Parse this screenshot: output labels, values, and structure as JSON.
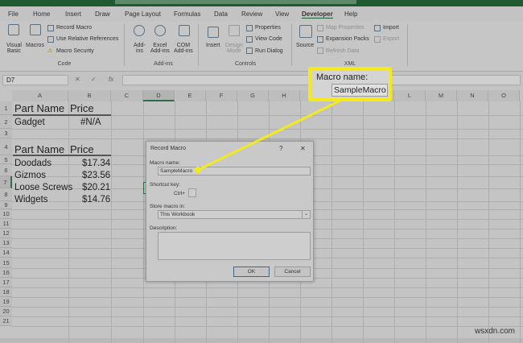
{
  "ribbon": {
    "tabs": [
      "File",
      "Home",
      "Insert",
      "Draw",
      "Page Layout",
      "Formulas",
      "Data",
      "Review",
      "View",
      "Developer",
      "Help"
    ],
    "active_tab": "Developer",
    "code": {
      "visual_basic": [
        "Visual",
        "Basic"
      ],
      "macros": "Macros",
      "record_macro": "Record Macro",
      "use_relative": "Use Relative References",
      "macro_security": "Macro Security",
      "label": "Code"
    },
    "addins": {
      "addins": [
        "Add-",
        "ins"
      ],
      "excel": [
        "Excel",
        "Add-ins"
      ],
      "com": [
        "COM",
        "Add-ins"
      ],
      "label": "Add-ins"
    },
    "controls": {
      "insert": "Insert",
      "design": [
        "Design",
        "Mode"
      ],
      "properties": "Properties",
      "view_code": "View Code",
      "run_dialog": "Run Dialog",
      "label": "Controls"
    },
    "xml": {
      "source": "Source",
      "map_properties": "Map Properties",
      "expansion_packs": "Expansion Packs",
      "refresh_data": "Refresh Data",
      "import": "Import",
      "export": "Export",
      "label": "XML"
    }
  },
  "formula_bar": {
    "name_box": "D7",
    "cancel": "✕",
    "enter": "✓",
    "fx": "fx",
    "value": ""
  },
  "columns": [
    "A",
    "B",
    "C",
    "D",
    "E",
    "F",
    "G",
    "H",
    "I",
    "J",
    "K",
    "L",
    "M",
    "N",
    "O"
  ],
  "rows": [
    "1",
    "2",
    "3",
    "4",
    "5",
    "6",
    "7",
    "8",
    "9",
    "10",
    "11",
    "12",
    "13",
    "14",
    "15",
    "16",
    "17",
    "18",
    "19",
    "20",
    "21"
  ],
  "cells": {
    "a1": "Part Name",
    "b1": "Price",
    "a2": "Gadget",
    "b2": "#N/A",
    "a4": "Part Name",
    "b4": "Price",
    "a5": "Doodads",
    "b5": "$17.34",
    "a6": "Gizmos",
    "b6": "$23.56",
    "a7": "Loose Screws",
    "b7": "$20.21",
    "a8": "Widgets",
    "b8": "$14.76"
  },
  "dialog": {
    "title": "Record Macro",
    "help": "?",
    "close": "✕",
    "macro_name_label": "Macro name:",
    "macro_name": "SampleMacro",
    "shortcut_label": "Shortcut key:",
    "ctrl": "Ctrl+",
    "store_label": "Store macro in:",
    "store_value": "This Workbook",
    "description_label": "Description:",
    "ok": "OK",
    "cancel": "Cancel"
  },
  "callout": {
    "label": "Macro name:",
    "value": "SampleMacro",
    "color": "#f2ea1c"
  },
  "watermark": "wsxdn.com"
}
